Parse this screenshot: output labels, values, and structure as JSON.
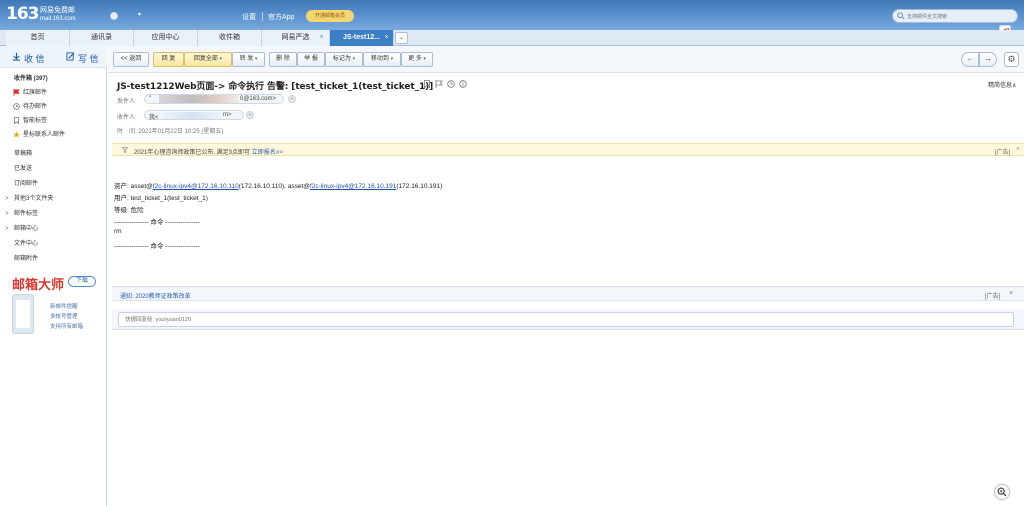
{
  "header": {
    "logo_number": "163",
    "logo_text": "网易免费邮",
    "logo_domain": "mail.163.com",
    "user_dropdown": "▾",
    "nav": [
      "设置",
      "官方App"
    ],
    "vip_badge": "开通邮箱会员",
    "search_placeholder": "支持邮件全文搜索"
  },
  "tabs": [
    {
      "label": "首页",
      "active": false
    },
    {
      "label": "通讯录",
      "active": false
    },
    {
      "label": "应用中心",
      "active": false
    },
    {
      "label": "收件箱",
      "active": false
    },
    {
      "label": "网易严选",
      "active": false
    },
    {
      "label": "JS-test12...",
      "active": true
    }
  ],
  "tab_close": "×",
  "tab_more": "⌄",
  "sidebar": {
    "receive": "收 信",
    "compose": "写 信",
    "folders": [
      {
        "label": "收件箱 (397)",
        "icon": "",
        "arrow": ""
      },
      {
        "label": "红旗邮件",
        "icon": "red-flag-icon",
        "arrow": ""
      },
      {
        "label": "待办邮件",
        "icon": "clock-icon",
        "arrow": ""
      },
      {
        "label": "智能标签",
        "icon": "tag-icon",
        "arrow": ""
      },
      {
        "label": "星标联系人邮件",
        "icon": "star-icon",
        "arrow": ""
      },
      {
        "label": "草稿箱",
        "icon": "",
        "arrow": ""
      },
      {
        "label": "已发送",
        "icon": "",
        "arrow": ""
      },
      {
        "label": "订阅邮件",
        "icon": "",
        "arrow": ""
      },
      {
        "label": "其他3个文件夹",
        "icon": "",
        "arrow": ">"
      },
      {
        "label": "邮件标签",
        "icon": "",
        "arrow": ">"
      },
      {
        "label": "邮箱中心",
        "icon": "",
        "arrow": ">"
      },
      {
        "label": "文件中心",
        "icon": "",
        "arrow": ""
      },
      {
        "label": "邮箱附件",
        "icon": "",
        "arrow": ""
      }
    ],
    "promo": {
      "brand": "邮箱大师",
      "download": "下载",
      "features": [
        "新邮件提醒",
        "多帐号管理",
        "支持所有邮箱"
      ]
    }
  },
  "toolbar": {
    "buttons": [
      "<< 返回",
      "回 复",
      "回复全部",
      "转 发",
      "删 除",
      "举 报",
      "标记为",
      "移动到",
      "更 多"
    ],
    "dropdown": "▾",
    "prev": "←",
    "next": "→",
    "settings": "⚙"
  },
  "email": {
    "subject": "JS-test1212Web页面-> 命令执行 告警: [test_ticket_1(test_ticket_1)]",
    "details": "精简信息∧",
    "sender_label": "发件人:",
    "sender_prefix": "\"",
    "sender_suffix": "0@163.com>",
    "recipient_label": "收件人:",
    "recipient_prefix": "我<",
    "recipient_suffix": "m>",
    "time_label": "时　间:",
    "time_value": "2021年01月22日 10:25 (星期五)",
    "ad_text": "2021年心理咨询师政策已公布, 满足3点即可",
    "ad_link": "立即报名>>",
    "ad_tag": "[广告]",
    "body": {
      "asset_label": "资产: asset@",
      "asset1_link": "f2c-linux-ipv4@172.16.10.110",
      "asset1_ip": "(172.16.10.110), asset@",
      "asset2_link": "f2c-linux-ipv4@172.16.10.191",
      "asset2_ip": "(172.16.10.191)",
      "user": "用户: test_ticket_1(test_ticket_1)",
      "level": "等级: 危险",
      "divider_cmd": "---------------- 命令 ----------------",
      "command": "rm"
    },
    "notice": "通知: 2020教师证政策改革",
    "notice_tag": "[广告]",
    "close": "×",
    "reply_placeholder": "快捷回复给: youliyuan0120"
  },
  "colors": {
    "header_blue": "#4a84c4",
    "active_tab": "#3d7fc4",
    "link": "#1f54a7",
    "brand_red": "#d5382f",
    "ad_yellow": "#fdf8dc"
  }
}
